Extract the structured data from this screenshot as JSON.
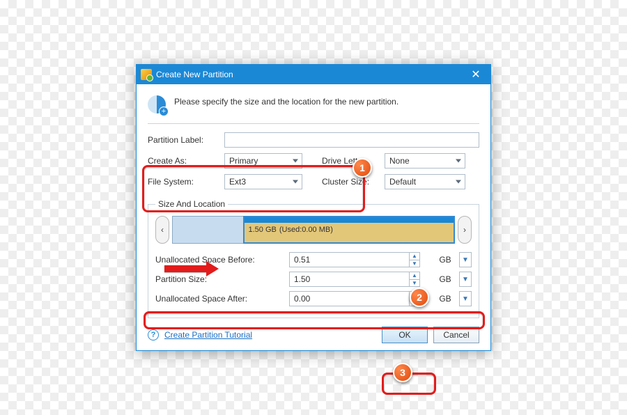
{
  "window": {
    "title": "Create New Partition"
  },
  "intro": "Please specify the size and the location for the new partition.",
  "labels": {
    "partition_label": "Partition Label:",
    "create_as": "Create As:",
    "drive_letter": "Drive Letter:",
    "file_system": "File System:",
    "cluster_size": "Cluster Size:",
    "size_and_location": "Size And Location",
    "unalloc_before": "Unallocated Space Before:",
    "partition_size": "Partition Size:",
    "unalloc_after": "Unallocated Space After:"
  },
  "values": {
    "partition_label": "",
    "create_as": "Primary",
    "drive_letter": "None",
    "file_system": "Ext3",
    "cluster_size": "Default",
    "disk_label_size": "1.50 GB",
    "disk_label_used": "(Used:0.00 MB)",
    "unalloc_before": "0.51",
    "partition_size": "1.50",
    "unalloc_after": "0.00",
    "unit": "GB"
  },
  "footer": {
    "help": "Create Partition Tutorial",
    "ok": "OK",
    "cancel": "Cancel"
  },
  "annotations": {
    "b1": "1",
    "b2": "2",
    "b3": "3"
  }
}
